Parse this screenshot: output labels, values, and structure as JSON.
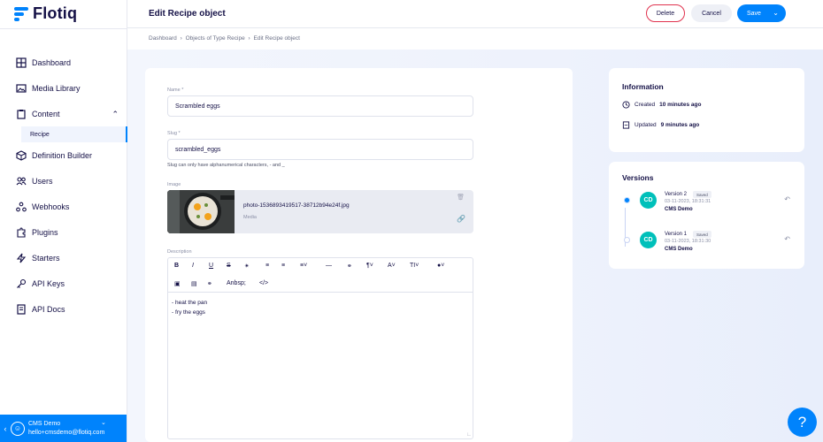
{
  "app": {
    "name": "Flotiq"
  },
  "sidebar": {
    "items": [
      {
        "label": "Dashboard",
        "icon": "dashboard-icon"
      },
      {
        "label": "Media Library",
        "icon": "image-icon"
      },
      {
        "label": "Content",
        "icon": "clipboard-icon",
        "expanded": true
      },
      {
        "label": "Definition Builder",
        "icon": "cube-icon"
      },
      {
        "label": "Users",
        "icon": "users-icon"
      },
      {
        "label": "Webhooks",
        "icon": "webhook-icon"
      },
      {
        "label": "Plugins",
        "icon": "puzzle-icon"
      },
      {
        "label": "Starters",
        "icon": "lightning-icon"
      },
      {
        "label": "API Keys",
        "icon": "key-icon"
      },
      {
        "label": "API Docs",
        "icon": "document-icon"
      }
    ],
    "sub_item": "Recipe",
    "user": {
      "name": "CMS Demo",
      "email": "hello+cmsdemo@flotiq.com"
    }
  },
  "header": {
    "title": "Edit Recipe object",
    "delete_label": "Delete",
    "cancel_label": "Cancel",
    "save_label": "Save"
  },
  "breadcrumb": [
    "Dashboard",
    "Objects of Type Recipe",
    "Edit Recipe object"
  ],
  "form": {
    "name_label": "Name *",
    "name_value": "Scrambled eggs",
    "slug_label": "Slug *",
    "slug_value": "scrambled_eggs",
    "slug_hint": "Slug can only have alphanumerical characters, - and _",
    "image_label": "Image",
    "image_filename": "photo-1536893419517-38712b94e24f.jpg",
    "image_type": "Media",
    "description_label": "Description",
    "toolbar_nbsp": "Anbsp;",
    "description_lines": [
      "- heat the pan",
      "- fry the eggs"
    ]
  },
  "info": {
    "title": "Information",
    "created_prefix": "Created",
    "created_value": "10 minutes ago",
    "updated_prefix": "Updated",
    "updated_value": "9 minutes ago"
  },
  "versions": {
    "title": "Versions",
    "items": [
      {
        "name": "Version 2",
        "badge": "Saved",
        "date": "03-11-2023, 18:31:31",
        "author": "CMS Demo",
        "initials": "CD",
        "active": true
      },
      {
        "name": "Version 1",
        "badge": "Saved",
        "date": "03-11-2023, 18:31:30",
        "author": "CMS Demo",
        "initials": "CD",
        "active": false
      }
    ]
  },
  "colors": {
    "accent": "#0083fc",
    "danger": "#e0324e",
    "avatar": "#00c0ba"
  }
}
